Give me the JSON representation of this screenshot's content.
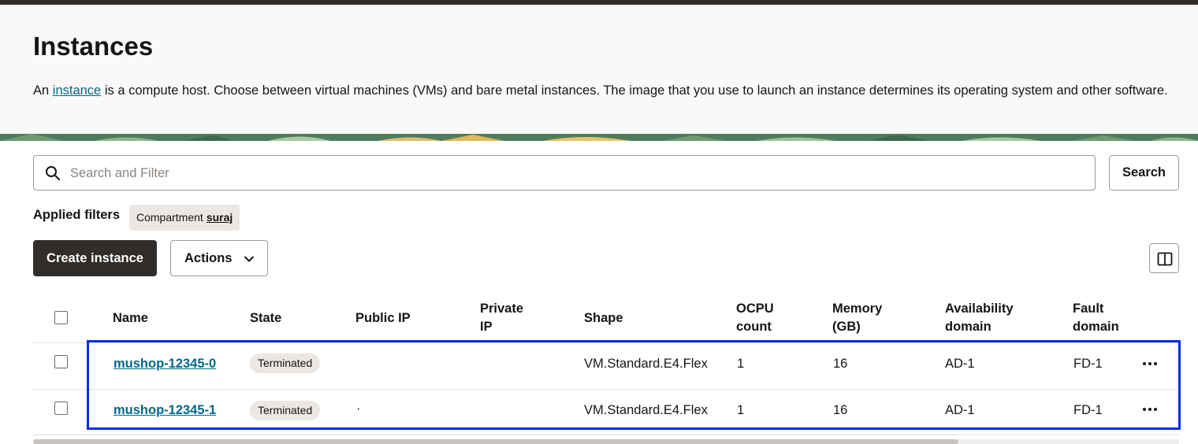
{
  "header": {
    "title": "Instances",
    "description_before": "An ",
    "description_link": "instance",
    "description_after": " is a compute host. Choose between virtual machines (VMs) and bare metal instances. The image that you use to launch an instance determines its operating system and other software."
  },
  "search": {
    "placeholder": "Search and Filter",
    "value": "",
    "button_label": "Search"
  },
  "filters": {
    "label": "Applied filters",
    "chip_key": "Compartment",
    "chip_value": "suraj"
  },
  "toolbar": {
    "create_label": "Create instance",
    "actions_label": "Actions"
  },
  "table": {
    "columns": {
      "name": "Name",
      "state": "State",
      "public_ip": "Public IP",
      "private_ip_1": "Private",
      "private_ip_2": "IP",
      "shape": "Shape",
      "ocpu_1": "OCPU",
      "ocpu_2": "count",
      "memory_1": "Memory",
      "memory_2": "(GB)",
      "ad_1": "Availability",
      "ad_2": "domain",
      "fd_1": "Fault",
      "fd_2": "domain"
    },
    "rows": [
      {
        "name": "mushop-12345-0",
        "state": "Terminated",
        "public_ip": "·",
        "shape": "VM.Standard.E4.Flex",
        "ocpu": "1",
        "memory": "16",
        "ad": "AD-1",
        "fd": "FD-1"
      },
      {
        "name": "mushop-12345-1",
        "state": "Terminated",
        "public_ip": "·",
        "shape": "VM.Standard.E4.Flex",
        "ocpu": "1",
        "memory": "16",
        "ad": "AD-1",
        "fd": "FD-1"
      }
    ]
  },
  "icons": {
    "search": "search-icon",
    "actions_chevron": "chevron-down-icon",
    "columns": "columns-icon",
    "row_menu": "more-horizontal-icon"
  },
  "colors": {
    "link": "#00688c",
    "primary_button": "#312d2a",
    "badge": "#ebe7e3",
    "highlight": "#0a2ee8"
  }
}
